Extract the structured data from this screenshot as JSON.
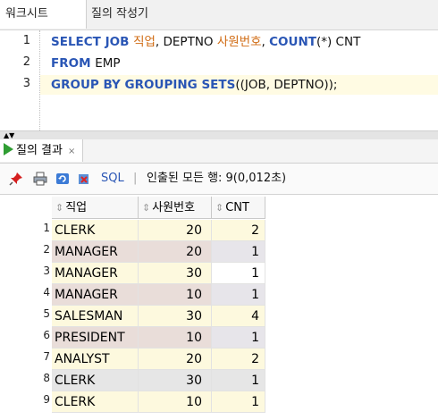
{
  "tabs": {
    "worksheet": "워크시트",
    "query_builder": "질의 작성기"
  },
  "editor": {
    "lines": [
      {
        "num": "1",
        "parts": [
          {
            "t": "SELECT JOB ",
            "k": "kw"
          },
          {
            "t": "직업",
            "k": "str"
          },
          {
            "t": ", DEPTNO ",
            "k": "plain"
          },
          {
            "t": "사원번호",
            "k": "str"
          },
          {
            "t": ", ",
            "k": "plain"
          },
          {
            "t": "COUNT",
            "k": "kw"
          },
          {
            "t": "(*) CNT",
            "k": "plain"
          }
        ]
      },
      {
        "num": "2",
        "parts": [
          {
            "t": "FROM ",
            "k": "kw"
          },
          {
            "t": "EMP",
            "k": "plain"
          }
        ]
      },
      {
        "num": "3",
        "parts": [
          {
            "t": "GROUP BY GROUPING SETS",
            "k": "kw"
          },
          {
            "t": "((JOB, DEPTNO));",
            "k": "plain"
          }
        ]
      }
    ]
  },
  "result": {
    "tab_label": "질의 결과",
    "close_glyph": "×",
    "toolbar": {
      "sql_label": "SQL",
      "separator": "|",
      "status": "인출된 모든 행: 9(0,012초)"
    },
    "columns": [
      "직업",
      "사원번호",
      "CNT"
    ],
    "rows": [
      {
        "n": "1",
        "job": "CLERK",
        "dept": "20",
        "cnt": "2",
        "shade": "r-yellow"
      },
      {
        "n": "2",
        "job": "MANAGER",
        "dept": "20",
        "cnt": "1",
        "shade": "r-mauve"
      },
      {
        "n": "3",
        "job": "MANAGER",
        "dept": "30",
        "cnt": "1",
        "shade": "r-plain"
      },
      {
        "n": "4",
        "job": "MANAGER",
        "dept": "10",
        "cnt": "1",
        "shade": "r-mauve"
      },
      {
        "n": "5",
        "job": "SALESMAN",
        "dept": "30",
        "cnt": "4",
        "shade": "r-yellow"
      },
      {
        "n": "6",
        "job": "PRESIDENT",
        "dept": "10",
        "cnt": "1",
        "shade": "r-mauve"
      },
      {
        "n": "7",
        "job": "ANALYST",
        "dept": "20",
        "cnt": "2",
        "shade": "r-yellow"
      },
      {
        "n": "8",
        "job": "CLERK",
        "dept": "30",
        "cnt": "1",
        "shade": "r-grey"
      },
      {
        "n": "9",
        "job": "CLERK",
        "dept": "10",
        "cnt": "1",
        "shade": "r-yellow"
      }
    ]
  },
  "colors": {
    "keyword": "#2a56b5",
    "alias": "#d06b13",
    "run": "#2f9e33"
  },
  "icons": [
    "pin-icon",
    "print-icon",
    "refresh-icon",
    "export-icon",
    "play-icon",
    "sort-icon"
  ]
}
